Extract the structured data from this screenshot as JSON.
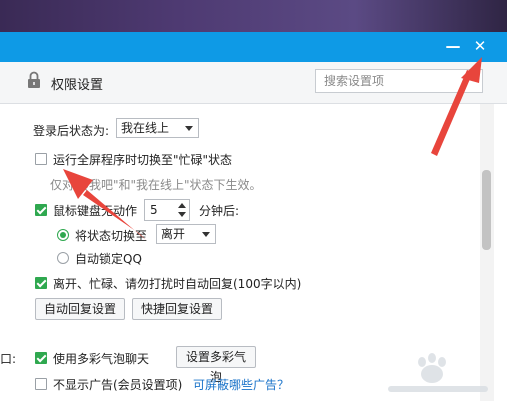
{
  "window": {
    "minimize_glyph": "—",
    "close_glyph": "✕"
  },
  "header": {
    "title": "权限设置",
    "search_placeholder": "搜索设置项"
  },
  "settings": {
    "login_status_label": "登录后状态为:",
    "login_status_value": "我在线上",
    "fullscreen_busy": {
      "label": "运行全屏程序时切换至\"忙碌\"状态",
      "checked": false
    },
    "fullscreen_hint": "仅对\"Q我吧\"和\"我在线上\"状态下生效。",
    "idle": {
      "label": "鼠标键盘无动作",
      "checked": true,
      "minutes": "5",
      "suffix": "分钟后:"
    },
    "idle_switch": {
      "label": "将状态切换至",
      "selected": true,
      "value": "离开"
    },
    "idle_lock": {
      "label": "自动锁定QQ",
      "selected": false
    },
    "auto_reply": {
      "label": "离开、忙碌、请勿打扰时自动回复(100字以内)",
      "checked": true
    },
    "auto_reply_button": "自动回复设置",
    "quick_reply_button": "快捷回复设置",
    "section_fragment": "口:",
    "bubble_chat": {
      "label": "使用多彩气泡聊天",
      "checked": true
    },
    "bubble_button": "设置多彩气泡",
    "no_ads": {
      "label": "不显示广告(会员设置项)",
      "checked": false
    },
    "no_ads_link": "可屏蔽哪些广告？"
  },
  "colors": {
    "titlebar": "#0e9ae6",
    "check_green": "#2fa84f",
    "annotation_red": "#e8453c",
    "link": "#1a73c9"
  }
}
